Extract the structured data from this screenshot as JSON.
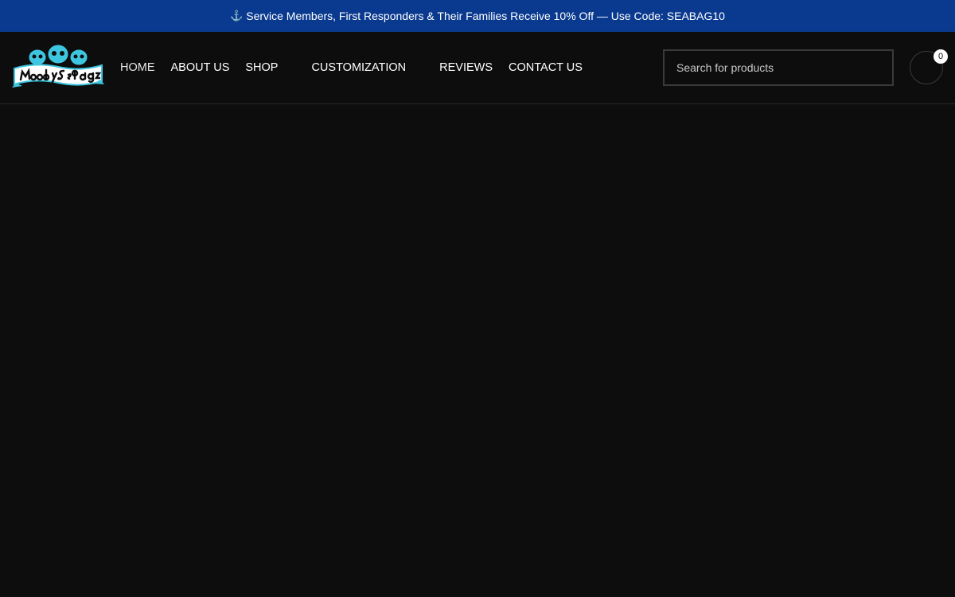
{
  "promo": {
    "icon": "anchor-icon",
    "text": "Service Members, First Responders & Their Families Receive 10% Off — Use Code: SEABAG10"
  },
  "brand": {
    "logo_alt": "Moody's Seabagz"
  },
  "nav": {
    "items": [
      {
        "label": "HOME",
        "has_dropdown": false
      },
      {
        "label": "ABOUT US",
        "has_dropdown": false
      },
      {
        "label": "SHOP",
        "has_dropdown": true
      },
      {
        "label": "CUSTOMIZATION",
        "has_dropdown": true
      },
      {
        "label": "REVIEWS",
        "has_dropdown": false
      },
      {
        "label": "CONTACT US",
        "has_dropdown": false
      }
    ]
  },
  "search": {
    "placeholder": "Search for products",
    "value": ""
  },
  "cart": {
    "icon": "cart-icon",
    "count": "0"
  },
  "colors": {
    "promo_bg": "#0a3a8f",
    "page_bg": "#0d0d0d",
    "logo_accent": "#3ec6e0"
  }
}
